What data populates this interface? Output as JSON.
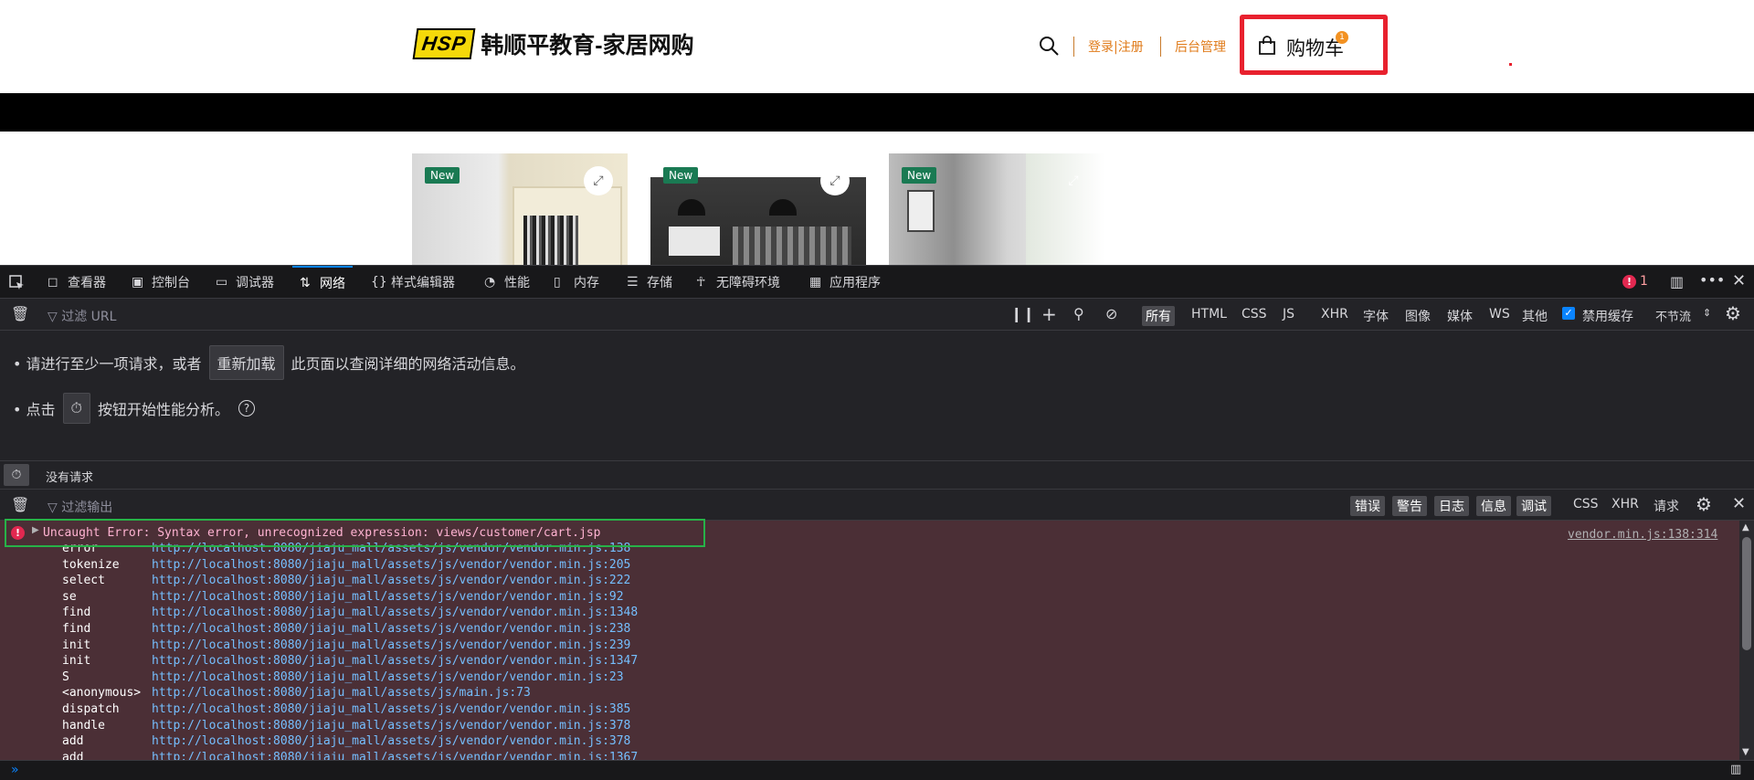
{
  "site": {
    "logo_badge": "HSP",
    "logo_text": "韩顺平教育-家居网购",
    "login_link": "登录|注册",
    "admin_link": "后台管理",
    "cart_label": "购物车",
    "cart_count": "1",
    "products": [
      {
        "badge": "New"
      },
      {
        "badge": "New"
      },
      {
        "badge": "New"
      }
    ]
  },
  "devtools": {
    "tabs": [
      {
        "label": "查看器",
        "icon": "inspector-icon"
      },
      {
        "label": "控制台",
        "icon": "console-icon"
      },
      {
        "label": "调试器",
        "icon": "debugger-icon"
      },
      {
        "label": "网络",
        "icon": "network-icon",
        "active": true
      },
      {
        "label": "样式编辑器",
        "icon": "style-editor-icon"
      },
      {
        "label": "性能",
        "icon": "performance-icon"
      },
      {
        "label": "内存",
        "icon": "memory-icon"
      },
      {
        "label": "存储",
        "icon": "storage-icon"
      },
      {
        "label": "无障碍环境",
        "icon": "accessibility-icon"
      },
      {
        "label": "应用程序",
        "icon": "application-icon"
      }
    ],
    "error_count": "1",
    "network": {
      "filter_placeholder": "过滤 URL",
      "types": [
        "所有",
        "HTML",
        "CSS",
        "JS",
        "XHR",
        "字体",
        "图像",
        "媒体",
        "WS",
        "其他"
      ],
      "disable_cache_label": "禁用缓存",
      "throttle_label": "不节流",
      "hint1_pre": "• 请进行至少一项请求，或者",
      "hint1_button": "重新加载",
      "hint1_post": "此页面以查阅详细的网络活动信息。",
      "hint2_pre": "• 点击",
      "hint2_post": "按钮开始性能分析。",
      "status": "没有请求"
    },
    "console": {
      "filter_placeholder": "过滤输出",
      "levels": [
        "错误",
        "警告",
        "日志",
        "信息",
        "调试"
      ],
      "types": [
        "CSS",
        "XHR",
        "请求"
      ],
      "error_message": "Uncaught Error: Syntax error, unrecognized expression: views/customer/cart.jsp",
      "error_source": "vendor.min.js:138:314",
      "trace": [
        {
          "fn": "error",
          "loc": "http://localhost:8080/jiaju_mall/assets/js/vendor/vendor.min.js:138"
        },
        {
          "fn": "tokenize",
          "loc": "http://localhost:8080/jiaju_mall/assets/js/vendor/vendor.min.js:205"
        },
        {
          "fn": "select",
          "loc": "http://localhost:8080/jiaju_mall/assets/js/vendor/vendor.min.js:222"
        },
        {
          "fn": "se",
          "loc": "http://localhost:8080/jiaju_mall/assets/js/vendor/vendor.min.js:92"
        },
        {
          "fn": "find",
          "loc": "http://localhost:8080/jiaju_mall/assets/js/vendor/vendor.min.js:1348"
        },
        {
          "fn": "find",
          "loc": "http://localhost:8080/jiaju_mall/assets/js/vendor/vendor.min.js:238"
        },
        {
          "fn": "init",
          "loc": "http://localhost:8080/jiaju_mall/assets/js/vendor/vendor.min.js:239"
        },
        {
          "fn": "init",
          "loc": "http://localhost:8080/jiaju_mall/assets/js/vendor/vendor.min.js:1347"
        },
        {
          "fn": "S",
          "loc": "http://localhost:8080/jiaju_mall/assets/js/vendor/vendor.min.js:23"
        },
        {
          "fn": "<anonymous>",
          "loc": "http://localhost:8080/jiaju_mall/assets/js/main.js:73"
        },
        {
          "fn": "dispatch",
          "loc": "http://localhost:8080/jiaju_mall/assets/js/vendor/vendor.min.js:385"
        },
        {
          "fn": "handle",
          "loc": "http://localhost:8080/jiaju_mall/assets/js/vendor/vendor.min.js:378"
        },
        {
          "fn": "add",
          "loc": "http://localhost:8080/jiaju_mall/assets/js/vendor/vendor.min.js:378"
        },
        {
          "fn": "add",
          "loc": "http://localhost:8080/jiaju_mall/assets/js/vendor/vendor.min.js:1367"
        }
      ]
    }
  }
}
